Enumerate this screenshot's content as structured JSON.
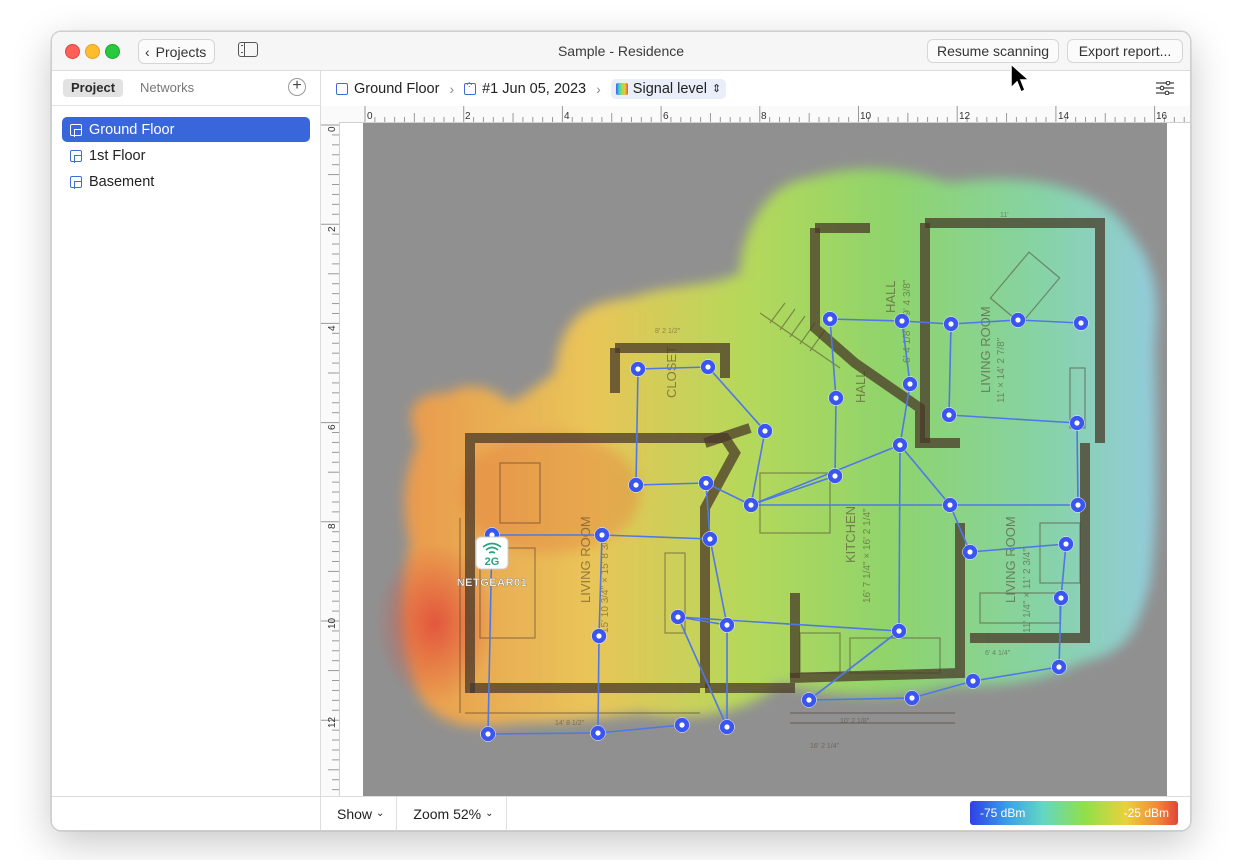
{
  "window": {
    "title": "Sample - Residence",
    "back_label": "Projects",
    "resume_label": "Resume scanning",
    "export_label": "Export report..."
  },
  "sidebar": {
    "tabs": [
      "Project",
      "Networks"
    ],
    "add_label": "+",
    "floors": [
      {
        "label": "Ground Floor",
        "selected": true
      },
      {
        "label": "1st Floor",
        "selected": false
      },
      {
        "label": "Basement",
        "selected": false
      }
    ]
  },
  "breadcrumb": {
    "floor": "Ground Floor",
    "scan": "#1 Jun 05, 2023",
    "view": "Signal level"
  },
  "rulers": {
    "top_ticks": [
      "0",
      "2",
      "4",
      "6",
      "8",
      "10",
      "12",
      "14",
      "16"
    ],
    "left_ticks": [
      "0",
      "2",
      "4",
      "6",
      "8",
      "10",
      "12"
    ]
  },
  "floorplan": {
    "rooms": [
      "LIVING ROOM",
      "KITCHEN",
      "LIVING ROOM",
      "LIVING ROOM",
      "HALL",
      "HALL",
      "CLOSET"
    ],
    "dimensions": [
      "15' 10 3/4\" × 15' 8 3/4\"",
      "16' 7 1/4\" × 16' 2 1/4\"",
      "11' × 14' 2 7/8\"",
      "11' 1/4\" × 11' 2 3/4\"",
      "6' 4 1/8\" × 9' 4 3/8\"",
      "14' 8 1/2\"",
      "16' 2 1/4\"",
      "10' 2 1/8\"",
      "6' 4 1/4\"",
      "11'",
      "8' 2 1/2\""
    ],
    "access_point": {
      "badge": "2G",
      "name": "NETGEAR01"
    }
  },
  "bottom": {
    "show_label": "Show",
    "zoom_label": "Zoom 52%",
    "legend_min": "-75 dBm",
    "legend_max": "-25 dBm"
  },
  "colors": {
    "accent": "#3a66dc",
    "scan_point": "#3a55f0",
    "heat_low": "#3a5cf0",
    "heat_high": "#e2443a"
  }
}
